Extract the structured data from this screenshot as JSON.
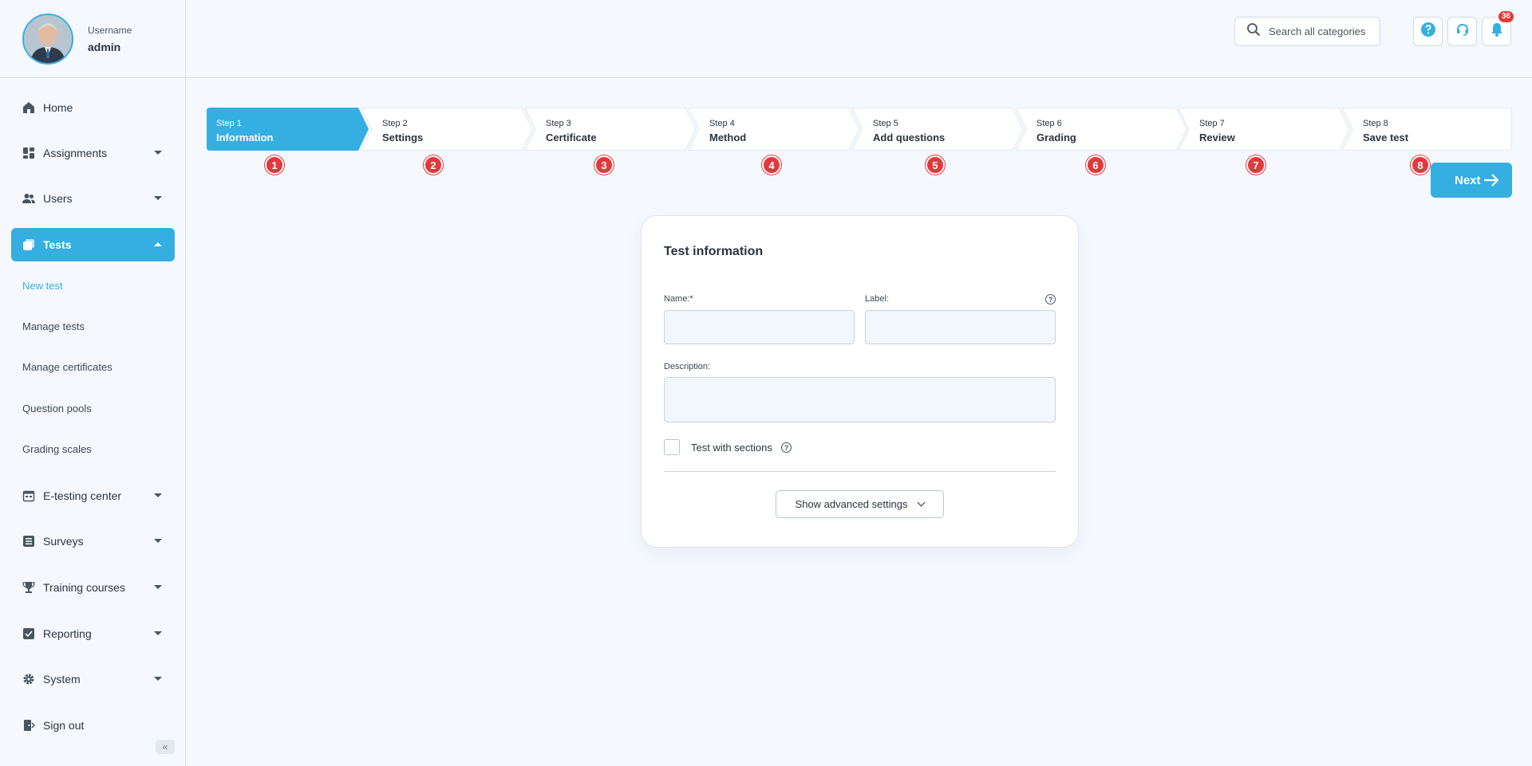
{
  "profile": {
    "label": "Username",
    "name": "admin"
  },
  "sidebar": {
    "items": [
      {
        "label": "Home",
        "icon": "home-icon"
      },
      {
        "label": "Assignments",
        "icon": "dashboard-icon"
      },
      {
        "label": "Users",
        "icon": "users-icon"
      },
      {
        "label": "Tests",
        "icon": "tests-icon"
      },
      {
        "label": "E-testing center",
        "icon": "calendar-icon"
      },
      {
        "label": "Surveys",
        "icon": "list-icon"
      },
      {
        "label": "Training courses",
        "icon": "trophy-icon"
      },
      {
        "label": "Reporting",
        "icon": "report-icon"
      },
      {
        "label": "System",
        "icon": "gear-icon"
      },
      {
        "label": "Sign out",
        "icon": "sign-out-icon"
      }
    ],
    "sub_items": [
      {
        "label": "New test"
      },
      {
        "label": "Manage tests"
      },
      {
        "label": "Manage certificates"
      },
      {
        "label": "Question pools"
      },
      {
        "label": "Grading scales"
      }
    ],
    "collapse_glyph": "«"
  },
  "header": {
    "search_placeholder": "Search all categories",
    "notifications_count": "36"
  },
  "stepper": {
    "steps": [
      {
        "num": "Step 1",
        "name": "Information",
        "marker": "1"
      },
      {
        "num": "Step 2",
        "name": "Settings",
        "marker": "2"
      },
      {
        "num": "Step 3",
        "name": "Certificate",
        "marker": "3"
      },
      {
        "num": "Step 4",
        "name": "Method",
        "marker": "4"
      },
      {
        "num": "Step 5",
        "name": "Add questions",
        "marker": "5"
      },
      {
        "num": "Step 6",
        "name": "Grading",
        "marker": "6"
      },
      {
        "num": "Step 7",
        "name": "Review",
        "marker": "7"
      },
      {
        "num": "Step 8",
        "name": "Save test",
        "marker": "8"
      }
    ],
    "next_label": "Next"
  },
  "card": {
    "title": "Test information",
    "name_label": "Name:*",
    "label_label": "Label:",
    "description_label": "Description:",
    "sections_label": "Test with sections",
    "advanced_label": "Show advanced settings",
    "help_glyph": "?"
  },
  "colors": {
    "accent": "#35aee2",
    "marker": "#e0393e",
    "badge": "#e53935"
  }
}
